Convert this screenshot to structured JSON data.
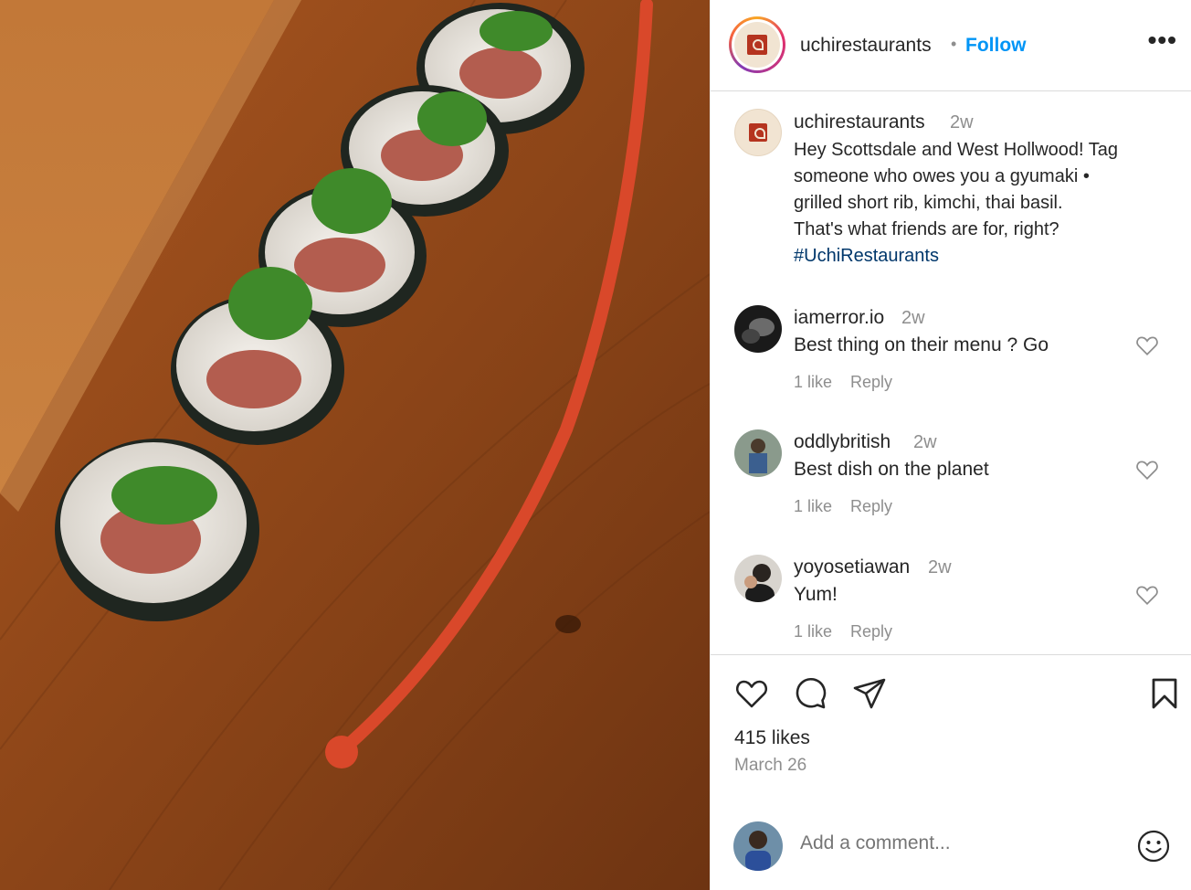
{
  "post": {
    "image_alt": "Sushi rolls with grilled short rib on a wooden board",
    "header": {
      "username": "uchirestaurants",
      "separator": "•",
      "follow_label": "Follow",
      "more_icon": "more-horizontal-icon"
    },
    "caption": {
      "username": "uchirestaurants",
      "time": "2w",
      "lines": [
        "Hey Scottsdale and West Hollwood! Tag",
        "someone who owes you a gyumaki •",
        "grilled short rib, kimchi, thai basil.",
        "That's what friends are for, right?"
      ],
      "hashtag": "#UchiRestaurants"
    },
    "comments": [
      {
        "username": "iamerror.io",
        "time": "2w",
        "text": "Best thing on their menu ? Go",
        "likes": "1 like",
        "reply": "Reply"
      },
      {
        "username": "oddlybritish",
        "time": "2w",
        "text": "Best dish on the planet",
        "likes": "1 like",
        "reply": "Reply"
      },
      {
        "username": "yoyosetiawan",
        "time": "2w",
        "text": "Yum!",
        "likes": "1 like",
        "reply": "Reply"
      }
    ],
    "actions": {
      "like_icon": "heart-icon",
      "comment_icon": "comment-icon",
      "share_icon": "share-icon",
      "save_icon": "bookmark-icon"
    },
    "likes_label": "415 likes",
    "date": "March 26",
    "add_comment_placeholder": "Add a comment...",
    "emoji_icon": "emoji-icon"
  },
  "colors": {
    "follow_blue": "#0095f6",
    "hashtag_blue": "#00376b",
    "muted_gray": "#8e8e8e",
    "text": "#262626"
  }
}
